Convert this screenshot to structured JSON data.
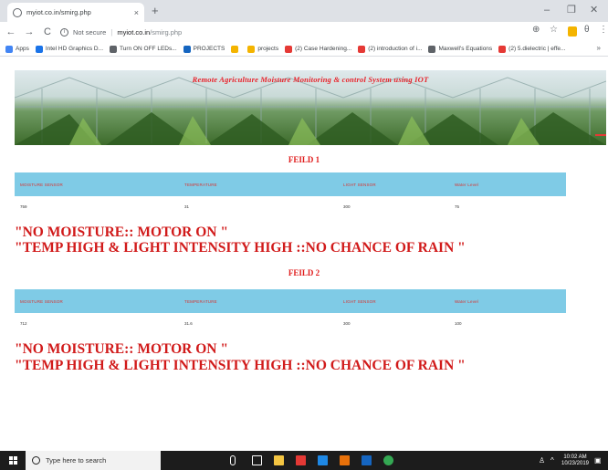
{
  "browser": {
    "tab_title": "myiot.co.in/smirg.php",
    "tab_close": "×",
    "new_tab": "+",
    "window_controls": [
      "–",
      "❐",
      "✕"
    ],
    "nav": {
      "back": "←",
      "forward": "→",
      "reload": "C"
    },
    "security": "Not secure",
    "url_domain": "myiot.co.in",
    "url_path": "/smirg.php",
    "toolbar_right": [
      "⊕",
      "☆",
      "⋮"
    ],
    "profile": "θ",
    "bookmarks": [
      {
        "label": "Apps",
        "color": "#4285f4"
      },
      {
        "label": "Intel HD Graphics D...",
        "color": "#1a73e8"
      },
      {
        "label": "Turn ON OFF LEDs...",
        "color": "#5f6368"
      },
      {
        "label": "PROJECTS",
        "color": "#1565c0"
      },
      {
        "label": "",
        "color": "#f4b400"
      },
      {
        "label": "projects",
        "color": "#f4b400"
      },
      {
        "label": "(2) Case Hardening...",
        "color": "#e53935"
      },
      {
        "label": "(2) introduction of i...",
        "color": "#e53935"
      },
      {
        "label": "Maxwell's Equations",
        "color": "#5f6368"
      },
      {
        "label": "(2) 5.dielectric | effe...",
        "color": "#e53935"
      }
    ],
    "bookmarks_more": "»"
  },
  "page": {
    "banner_title": "Remote Agriculture Moisture Monitoring & control System using IOT",
    "fields": [
      {
        "title": "FEILD 1",
        "headers": [
          "MOISTURE SENSOR",
          "TEMPERATURE",
          "LIGHT SENSOR",
          "Water Level"
        ],
        "values": [
          "759",
          "31",
          "300",
          "75"
        ],
        "messages": [
          "\"NO MOISTURE:: MOTOR ON \"",
          "\"TEMP HIGH & LIGHT INTENSITY HIGH ::NO CHANCE OF RAIN \""
        ]
      },
      {
        "title": "FEILD 2",
        "headers": [
          "MOISTURE SENSOR",
          "TEMPERATURE",
          "LIGHT SENSOR",
          "Water Level"
        ],
        "values": [
          "712",
          "31.6",
          "300",
          "100"
        ],
        "messages": [
          "\"NO MOISTURE:: MOTOR ON \"",
          "\"TEMP HIGH & LIGHT INTENSITY HIGH ::NO CHANCE OF RAIN \""
        ]
      }
    ]
  },
  "taskbar": {
    "search_placeholder": "Type here to search",
    "apps": [
      {
        "name": "microphone",
        "color": "#ffffff"
      },
      {
        "name": "task-view",
        "color": "#ffffff"
      },
      {
        "name": "file-explorer",
        "color": "#f4c542"
      },
      {
        "name": "pdf",
        "color": "#e53935"
      },
      {
        "name": "mail",
        "color": "#1e88e5"
      },
      {
        "name": "store",
        "color": "#e8710a"
      },
      {
        "name": "app-blue",
        "color": "#1565c0"
      },
      {
        "name": "chrome",
        "color": "#34a853"
      }
    ],
    "time": "10:02 AM",
    "date": "10/23/2019"
  }
}
